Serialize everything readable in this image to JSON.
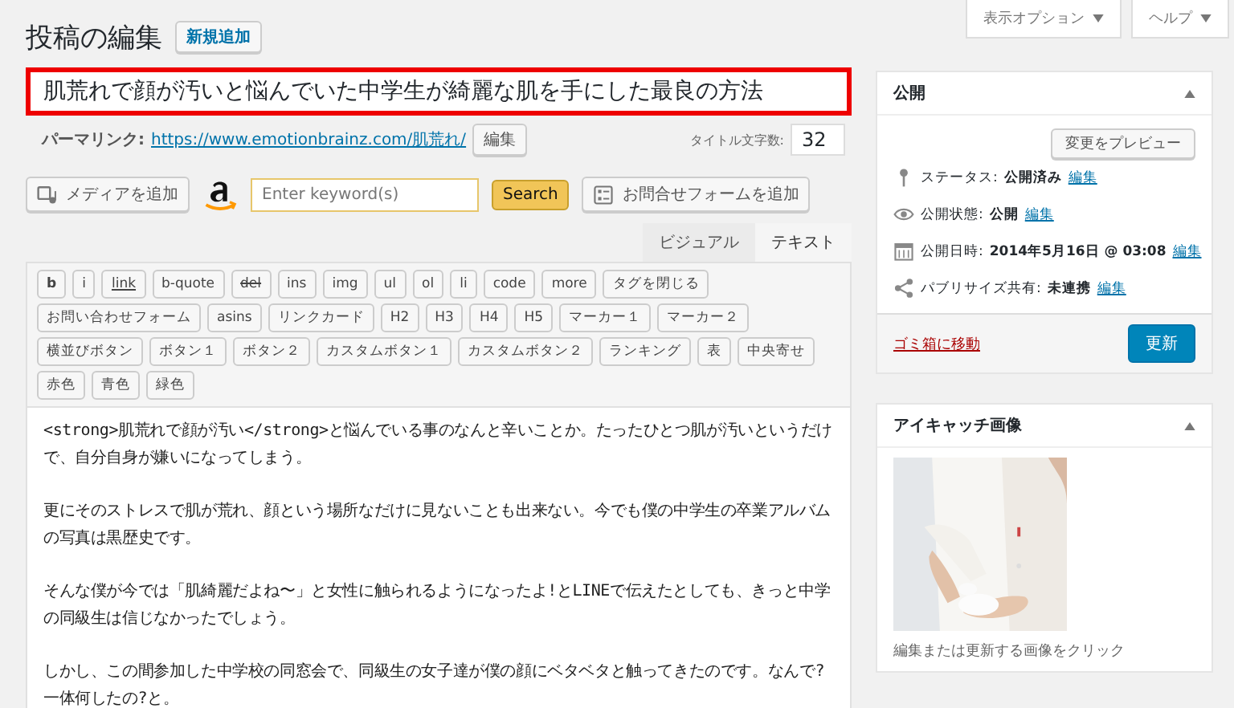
{
  "screen_meta": [
    {
      "label": "表示オプション"
    },
    {
      "label": "ヘルプ"
    }
  ],
  "heading": {
    "title": "投稿の編集",
    "add_new": "新規追加"
  },
  "title_field": {
    "value": "肌荒れで顔が汚いと悩んでいた中学生が綺麗な肌を手にした最良の方法"
  },
  "permalink": {
    "label": "パーマリンク:",
    "url": "https://www.emotionbrainz.com/肌荒れ/",
    "edit": "編集",
    "count_label": "タイトル文字数:",
    "count": "32"
  },
  "media_toolbar": {
    "add_media": "メディアを追加",
    "search": {
      "placeholder": "Enter keyword(s)"
    },
    "search_button": "Search",
    "contact_form": "お問合せフォームを追加"
  },
  "editor_tabs": [
    {
      "label": "ビジュアル",
      "selected": false
    },
    {
      "label": "テキスト",
      "selected": true
    }
  ],
  "quicktags": [
    [
      {
        "label": "b",
        "kind": "bold"
      },
      {
        "label": "i",
        "kind": "plain"
      },
      {
        "label": "link",
        "kind": "underline"
      },
      {
        "label": "b-quote",
        "kind": "plain"
      },
      {
        "label": "del",
        "kind": "strike"
      },
      {
        "label": "ins",
        "kind": "plain"
      },
      {
        "label": "img",
        "kind": "plain"
      },
      {
        "label": "ul",
        "kind": "plain"
      },
      {
        "label": "ol",
        "kind": "plain"
      },
      {
        "label": "li",
        "kind": "plain"
      },
      {
        "label": "code",
        "kind": "plain"
      },
      {
        "label": "more",
        "kind": "plain"
      },
      {
        "label": "タグを閉じる",
        "kind": "plain"
      }
    ],
    [
      {
        "label": "お問い合わせフォーム",
        "kind": "plain"
      },
      {
        "label": "asins",
        "kind": "plain"
      },
      {
        "label": "リンクカード",
        "kind": "plain"
      },
      {
        "label": "H2",
        "kind": "plain"
      },
      {
        "label": "H3",
        "kind": "plain"
      },
      {
        "label": "H4",
        "kind": "plain"
      },
      {
        "label": "H5",
        "kind": "plain"
      },
      {
        "label": "マーカー１",
        "kind": "plain"
      },
      {
        "label": "マーカー２",
        "kind": "plain"
      }
    ],
    [
      {
        "label": "横並びボタン",
        "kind": "plain"
      },
      {
        "label": "ボタン１",
        "kind": "plain"
      },
      {
        "label": "ボタン２",
        "kind": "plain"
      },
      {
        "label": "カスタムボタン１",
        "kind": "plain"
      },
      {
        "label": "カスタムボタン２",
        "kind": "plain"
      },
      {
        "label": "ランキング",
        "kind": "plain"
      },
      {
        "label": "表",
        "kind": "plain"
      },
      {
        "label": "中央寄せ",
        "kind": "plain"
      }
    ],
    [
      {
        "label": "赤色",
        "kind": "plain"
      },
      {
        "label": "青色",
        "kind": "plain"
      },
      {
        "label": "緑色",
        "kind": "plain"
      }
    ]
  ],
  "content": [
    "<strong>肌荒れで顔が汚い</strong>と悩んでいる事のなんと辛いことか。たったひとつ肌が汚いというだけで、自分自身が嫌いになってしまう。",
    "更にそのストレスで肌が荒れ、顔という場所なだけに見ないことも出来ない。今でも僕の中学生の卒業アルバムの写真は黒歴史です。",
    "そんな僕が今では「肌綺麗だよね〜」と女性に触られるようになったよ!とLINEで伝えたとしても、きっと中学の同級生は信じなかったでしょう。",
    "しかし、この間参加した中学校の同窓会で、同級生の女子達が僕の顔にベタベタと触ってきたのです。なんで?一体何したの?と。"
  ],
  "publish_box": {
    "title": "公開",
    "preview": "変更をプレビュー",
    "rows": [
      {
        "kind": "pin",
        "label": "ステータス:",
        "value": "公開済み",
        "edit": "編集"
      },
      {
        "kind": "eye",
        "label": "公開状態:",
        "value": "公開",
        "edit": "編集"
      },
      {
        "kind": "calendar",
        "label": "公開日時:",
        "value": "2014年5月16日 @ 03:08",
        "edit": "編集"
      },
      {
        "kind": "share",
        "label": "パブリサイズ共有:",
        "value": "未連携",
        "edit": "編集"
      }
    ],
    "trash": "ゴミ箱に移動",
    "update": "更新"
  },
  "featured_image": {
    "title": "アイキャッチ画像",
    "caption": "編集または更新する画像をクリック"
  }
}
